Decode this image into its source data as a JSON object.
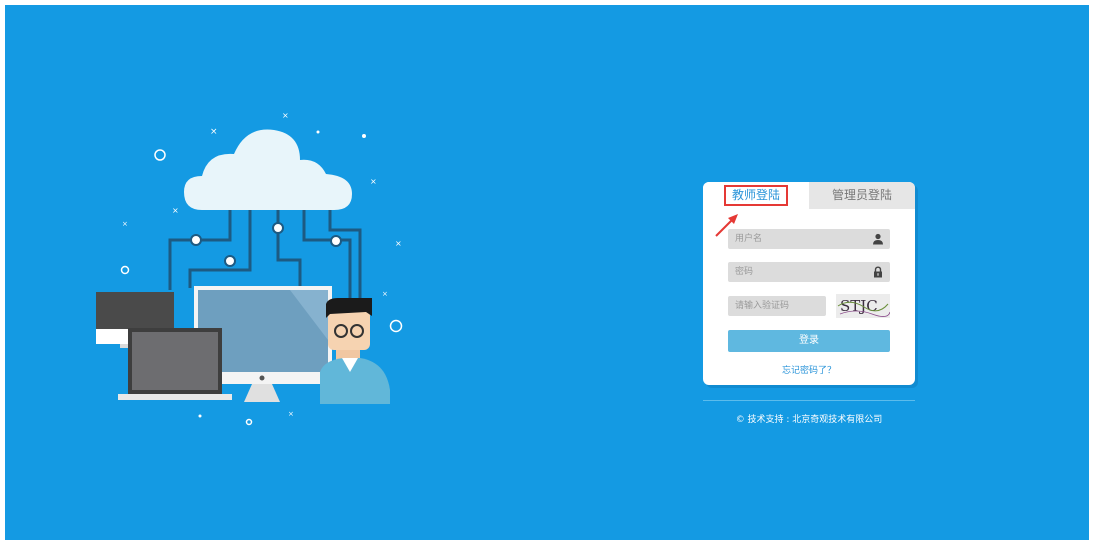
{
  "colors": {
    "background": "#149ae3",
    "accent": "#2a94d9",
    "button": "#5fb8e0",
    "highlight": "#e53935"
  },
  "login": {
    "tabs": [
      {
        "label": "教师登陆",
        "active": true
      },
      {
        "label": "管理员登陆",
        "active": false
      }
    ],
    "username": {
      "placeholder": "用户名",
      "icon": "user-icon"
    },
    "password": {
      "placeholder": "密码",
      "icon": "lock-icon"
    },
    "captcha": {
      "placeholder": "请输入验证码",
      "image_text": "STJC"
    },
    "submit_label": "登录",
    "forgot_label": "忘记密码了？"
  },
  "footer": {
    "text": "© 技术支持 : 北京奇观技术有限公司"
  }
}
